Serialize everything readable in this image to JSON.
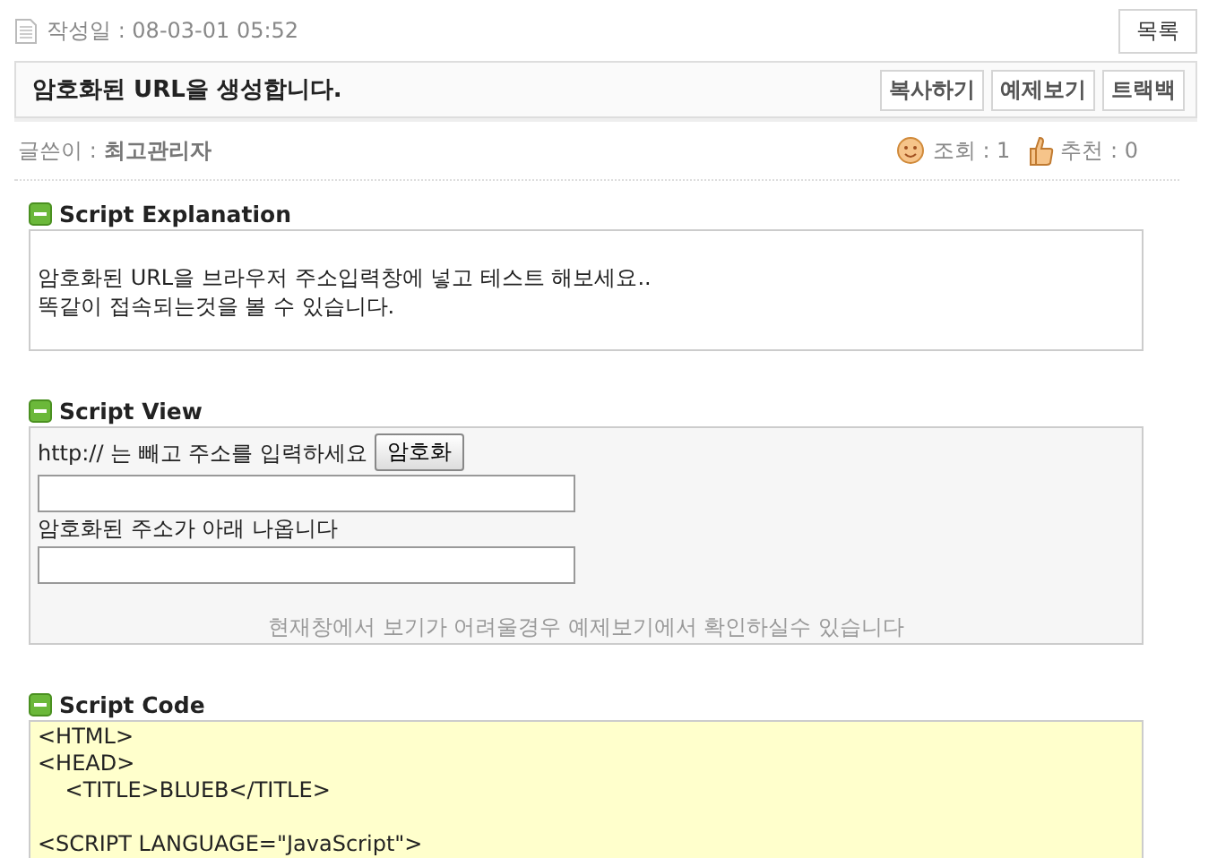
{
  "post": {
    "date_label": "작성일 : 08-03-01 05:52",
    "list_button": "목록",
    "title": "암호화된 URL을 생성합니다.",
    "title_buttons": [
      "복사하기",
      "예제보기",
      "트랙백"
    ],
    "author_label": "글쓴이 :",
    "author": "최고관리자",
    "views": "조회 : 1",
    "recommends": "추천 : 0"
  },
  "explanation": {
    "heading": "Script Explanation",
    "lines": [
      "암호화된 URL을 브라우저 주소입력창에 넣고 테스트 해보세요..",
      "똑같이 접속되는것을 볼 수 있습니다."
    ]
  },
  "view": {
    "heading": "Script View",
    "prompt": "http:// 는 빼고 주소를 입력하세요",
    "encrypt_button": "암호화",
    "result_label": "암호화된 주소가 아래 나옵니다",
    "note": "현재창에서 보기가 어려울경우 예제보기에서 확인하실수 있습니다"
  },
  "code": {
    "heading": "Script Code",
    "blocks": [
      [
        "<HTML>",
        "<HEAD>",
        "    <TITLE>BLUEB</TITLE>"
      ],
      [
        "<SCRIPT LANGUAGE=\"JavaScript\">"
      ]
    ]
  }
}
